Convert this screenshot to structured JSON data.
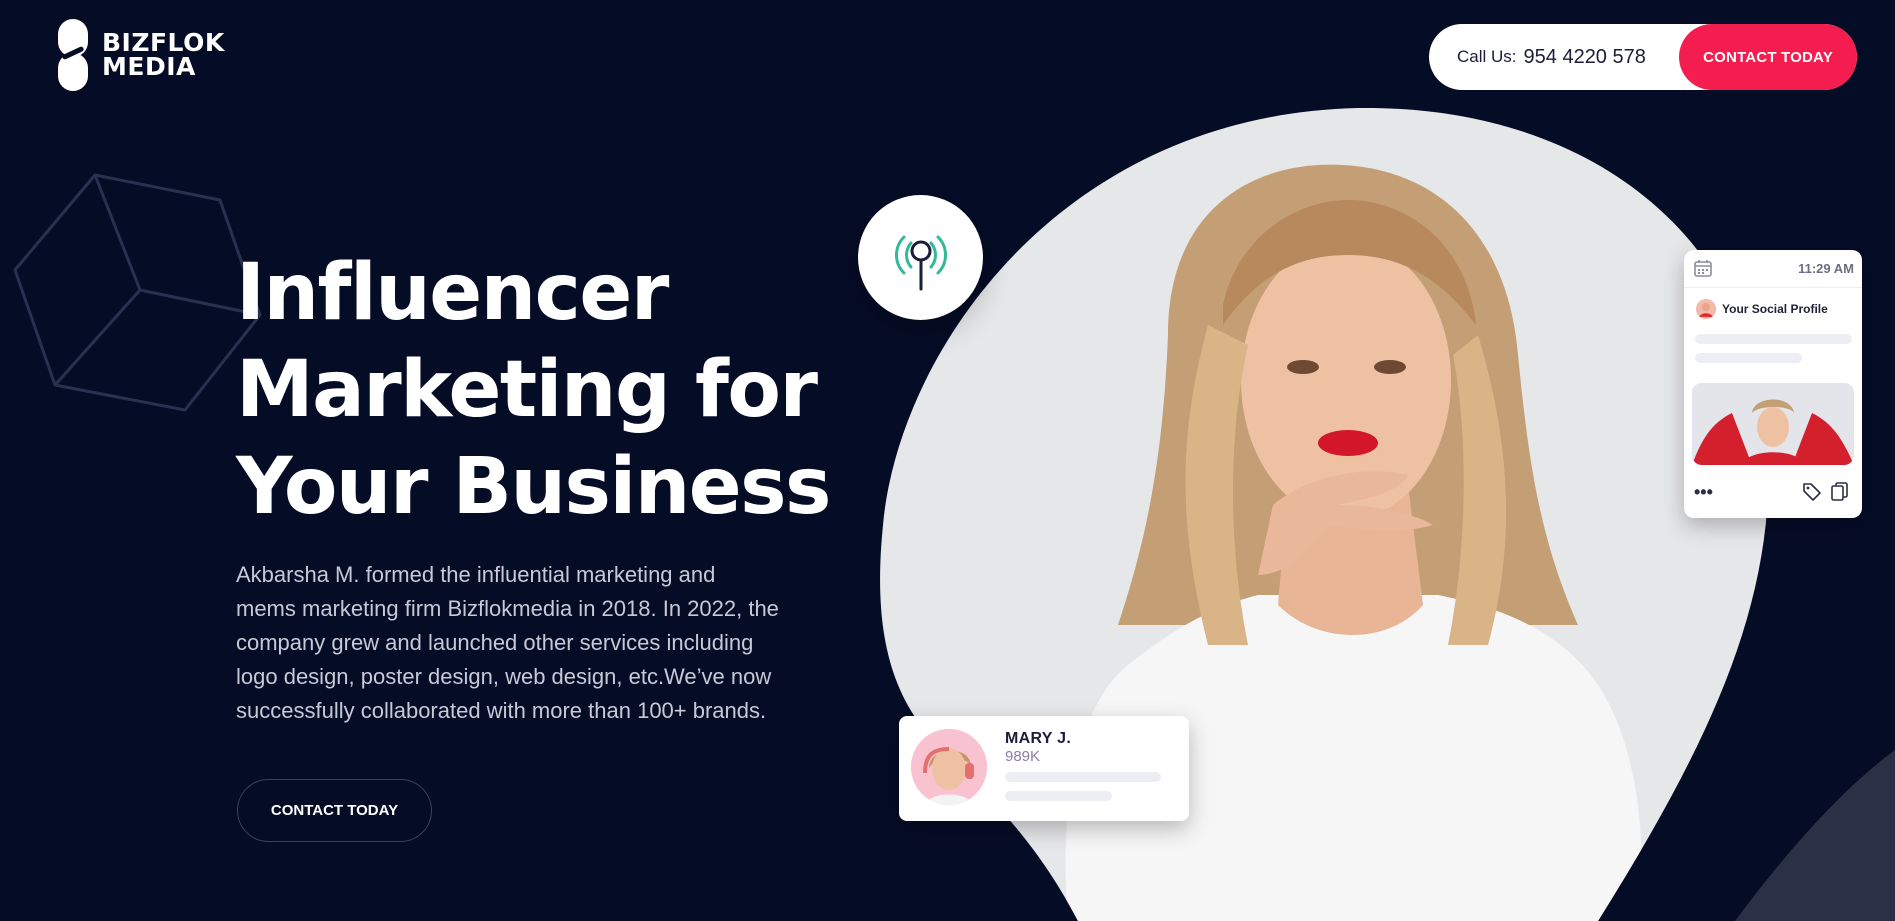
{
  "brand": {
    "name_line1": "BIZFLOK",
    "name_line2": "MEDIA",
    "logo_icon": "bizflok-logo-icon"
  },
  "header": {
    "call_label": "Call Us:",
    "phone": "954 4220 578",
    "contact_button": "CONTACT TODAY"
  },
  "hero": {
    "title_lines": [
      "Influencer",
      "Marketing for",
      "Your Business"
    ],
    "description_lines": [
      "Akbarsha M. formed the influential marketing and",
      "mems marketing firm Bizflokmedia in 2018. In 2022, the",
      "company grew and launched other services including",
      "logo design, poster design, web design, etc.We’ve now",
      "successfully collaborated with more than 100+ brands."
    ],
    "cta_button": "CONTACT TODAY"
  },
  "social_card": {
    "time": "11:29 AM",
    "profile_label": "Your Social Profile",
    "calendar_icon": "calendar-icon",
    "more_icon": "more-dots-icon",
    "tag_icon": "tag-icon",
    "copy_icon": "copy-icon"
  },
  "influencer_card": {
    "name": "MARY J.",
    "followers": "989K"
  },
  "decor": {
    "antenna_icon": "broadcast-antenna-icon",
    "cube_icon": "wireframe-cube-icon"
  },
  "colors": {
    "background": "#050c26",
    "accent": "#f31e4f",
    "antenna_teal": "#35b79a",
    "blob": "#e6e7e9"
  }
}
